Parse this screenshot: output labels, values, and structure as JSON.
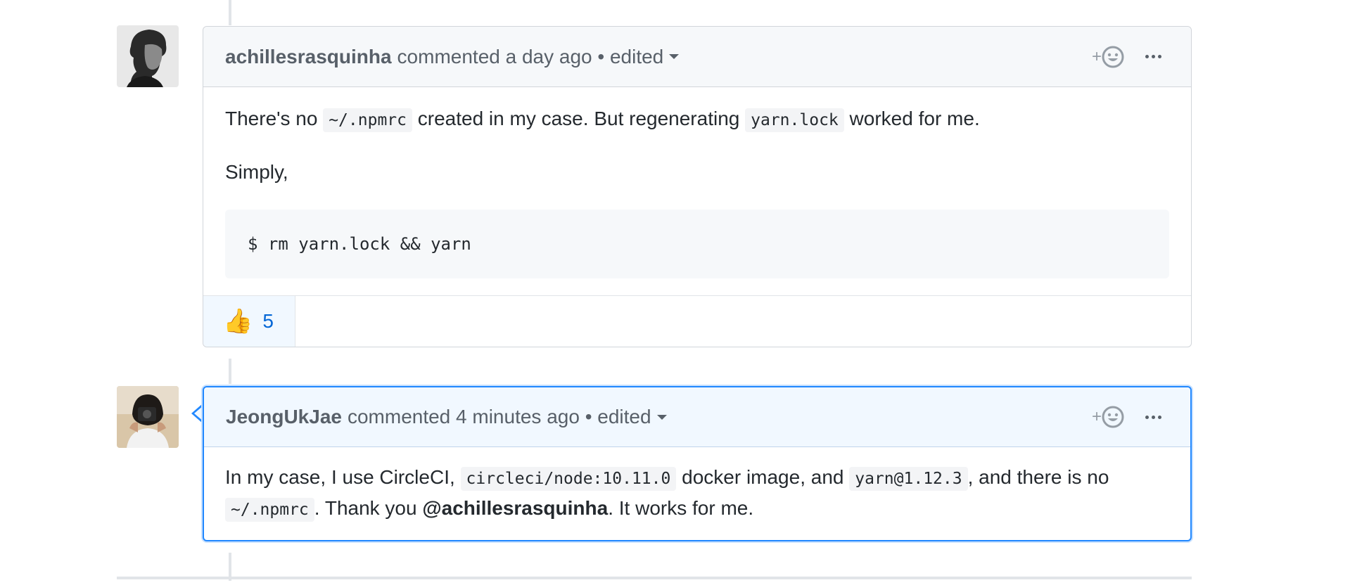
{
  "comments": [
    {
      "author": "achillesrasquinha",
      "meta": "commented a day ago • edited",
      "body": {
        "p1_before": "There's no ",
        "p1_code1": "~/.npmrc",
        "p1_middle": " created in my case. But regenerating ",
        "p1_code2": "yarn.lock",
        "p1_after": " worked for me.",
        "p2": "Simply,",
        "code_block": "$ rm yarn.lock && yarn"
      },
      "reaction": {
        "emoji": "👍",
        "count": "5"
      },
      "react_plus": "+"
    },
    {
      "author": "JeongUkJae",
      "meta": "commented 4 minutes ago • edited",
      "body": {
        "before": "In my case, I use CircleCI, ",
        "code1": "circleci/node:10.11.0",
        "mid1": " docker image, and ",
        "code2": "yarn@1.12.3",
        "mid2": ", and there is no ",
        "code3": "~/.npmrc",
        "mid3": ". Thank you ",
        "mention": "@achillesrasquinha",
        "after": ". It works for me."
      },
      "react_plus": "+"
    }
  ],
  "colors": {
    "accent_blue": "#2188ff",
    "link_blue": "#0366d6",
    "header_bg": "#f6f8fa",
    "current_header_bg": "#f1f8ff",
    "border": "#d1d5da"
  },
  "icons": {
    "add_reaction": "smiley-icon",
    "more": "kebab-horizontal-icon",
    "caret": "triangle-down-icon"
  }
}
